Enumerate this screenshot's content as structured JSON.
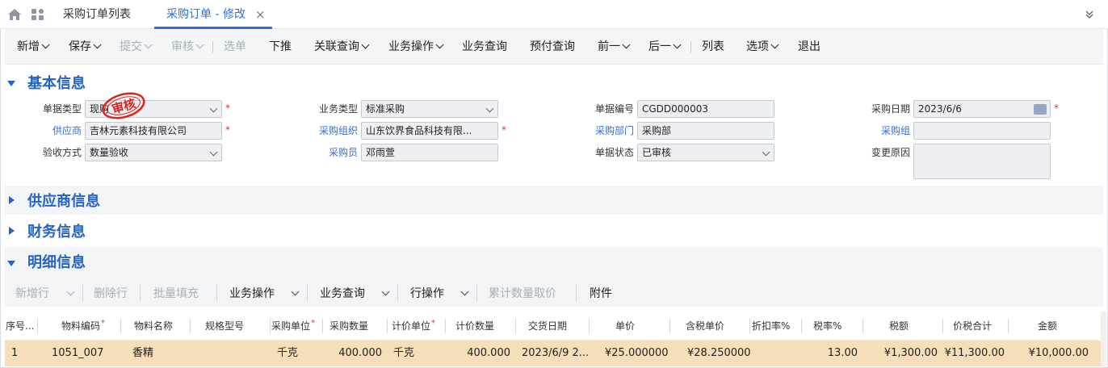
{
  "tabs": [
    {
      "label": "采购订单列表"
    },
    {
      "label": "采购订单 - 修改",
      "close": "×"
    }
  ],
  "toolbar": {
    "new": "新增",
    "save": "保存",
    "submit": "提交",
    "audit": "审核",
    "select_bill": "选单",
    "push_down": "下推",
    "related_query": "关联查询",
    "business_ops": "业务操作",
    "business_query": "业务查询",
    "prepay_query": "预付查询",
    "prev": "前一",
    "next": "后一",
    "list": "列表",
    "options": "选项",
    "exit": "退出"
  },
  "sections": {
    "basic": "基本信息",
    "supplier": "供应商信息",
    "finance": "财务信息",
    "detail": "明细信息"
  },
  "form": {
    "bill_type": {
      "label": "单据类型",
      "value": "现购"
    },
    "business_type": {
      "label": "业务类型",
      "value": "标准采购"
    },
    "bill_no": {
      "label": "单据编号",
      "value": "CGDD000003"
    },
    "purchase_date": {
      "label": "采购日期",
      "value": "2023/6/6"
    },
    "supplier": {
      "label": "供应商",
      "value": "吉林元素科技有限公司"
    },
    "purchase_org": {
      "label": "采购组织",
      "value": "山东饮界食品科技有限..."
    },
    "purchase_dept": {
      "label": "采购部门",
      "value": "采购部"
    },
    "purchase_group": {
      "label": "采购组",
      "value": ""
    },
    "inspection": {
      "label": "验收方式",
      "value": "数量验收"
    },
    "purchaser": {
      "label": "采购员",
      "value": "邓雨萱"
    },
    "bill_status": {
      "label": "单据状态",
      "value": "已审核"
    },
    "change_reason": {
      "label": "变更原因",
      "value": ""
    },
    "required_mark": "*",
    "stamp_text": "审核"
  },
  "detail_toolbar": {
    "add_row": "新增行",
    "delete_row": "删除行",
    "batch_fill": "批量填充",
    "business_ops": "业务操作",
    "business_query": "业务查询",
    "row_ops": "行操作",
    "cumulative_price": "累计数量取价",
    "attachment": "附件"
  },
  "grid": {
    "columns": [
      "序号...",
      "物料编码",
      "物料名称",
      "规格型号",
      "采购单位",
      "采购数量",
      "计价单位",
      "计价数量",
      "交货日期",
      "单价",
      "含税单价",
      "折扣率%",
      "税率%",
      "税额",
      "价税合计",
      "金额"
    ],
    "rows": [
      {
        "seq": "1",
        "material_code": "1051_007",
        "material_name": "香精",
        "spec": "",
        "purchase_unit": "千克",
        "purchase_qty": "400.000",
        "pricing_unit": "千克",
        "pricing_qty": "400.000",
        "delivery_date": "2023/6/9 2...",
        "unit_price": "¥25.000000",
        "tax_unit_price": "¥28.250000",
        "discount": "",
        "tax_rate": "13.00",
        "tax_amount": "¥1,300.00",
        "total": "¥11,300.00",
        "amount": "¥10,000.00"
      }
    ]
  },
  "colors": {
    "accent": "#2f6fd6",
    "section_title": "#2464c4",
    "required": "#e0302a",
    "selected_row": "#f5deba",
    "stamp": "#d9261c"
  }
}
